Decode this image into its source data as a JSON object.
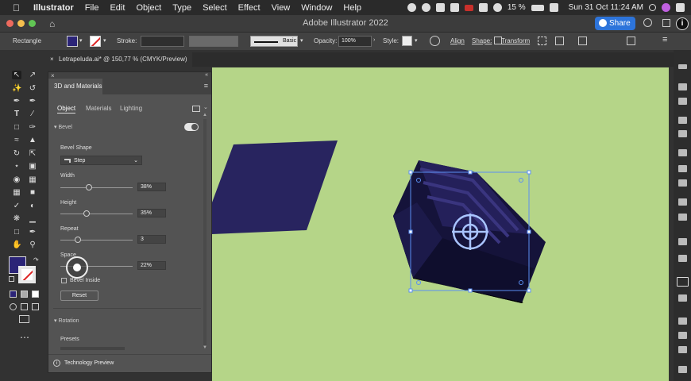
{
  "menubar": {
    "app": "Illustrator",
    "items": [
      "File",
      "Edit",
      "Object",
      "Type",
      "Select",
      "Effect",
      "View",
      "Window",
      "Help"
    ],
    "battery": "15 %",
    "datetime": "Sun 31 Oct  11:24 AM"
  },
  "titlebar": {
    "title": "Adobe Illustrator 2022",
    "share_label": "Share"
  },
  "controlbar": {
    "selection": "Rectangle",
    "stroke_label": "Stroke:",
    "brush_label": "Basic",
    "opacity_label": "Opacity:",
    "opacity_value": "100%",
    "style_label": "Style:",
    "align_label": "Align",
    "shape_label": "Shape:",
    "transform_label": "Transform"
  },
  "document_tab": {
    "title": "Letrapeluda.ai* @ 150,77 % (CMYK/Preview)"
  },
  "panel": {
    "title": "3D and Materials",
    "tabs": [
      "Object",
      "Materials",
      "Lighting"
    ],
    "bevel": {
      "section": "Bevel",
      "shape_label": "Bevel Shape",
      "shape_value": "Step",
      "width_label": "Width",
      "width_value": "38%",
      "height_label": "Height",
      "height_value": "35%",
      "repeat_label": "Repeat",
      "repeat_value": "3",
      "space_label": "Space",
      "space_value": "22%",
      "inside_label": "Bevel Inside",
      "reset_label": "Reset"
    },
    "rotation": {
      "section": "Rotation",
      "presets_label": "Presets"
    },
    "footer": "Technology Preview"
  },
  "colors": {
    "fill": "#2b2477",
    "object": "#28245f",
    "canvas": "#b5d588",
    "accent": "#2d74da",
    "selection": "#4a86f0"
  }
}
